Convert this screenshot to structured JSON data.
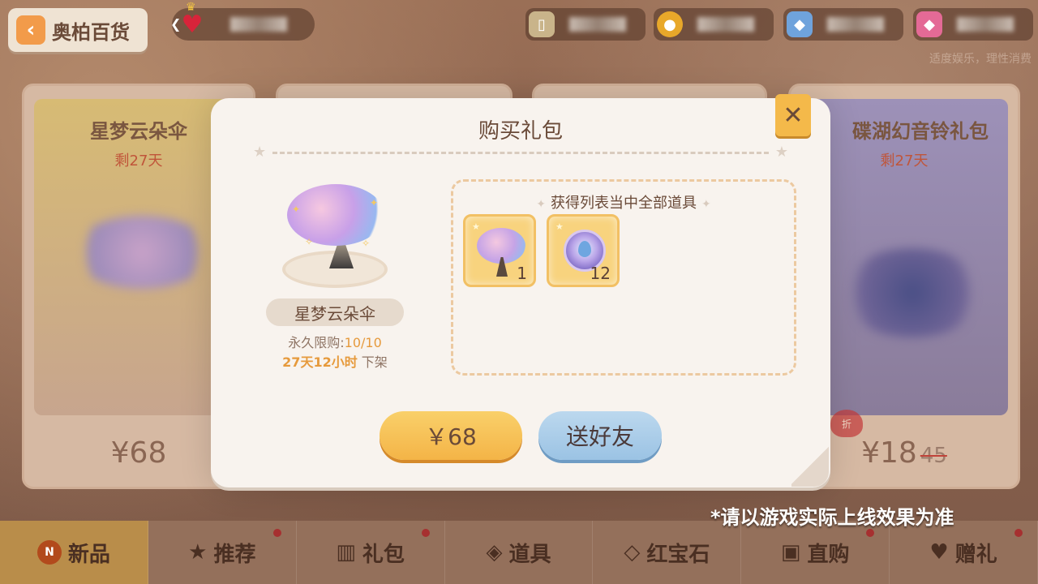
{
  "header": {
    "back_label": "奥柏百货",
    "notice": "适度娱乐，理性消费"
  },
  "background_cards": [
    {
      "name": "星梦云朵伞",
      "days": "剩27天",
      "price": "¥68"
    },
    {
      "name": "碟湖幻音铃礼包",
      "days": "剩27天",
      "price": "¥18",
      "old_price": "45",
      "discount_label": "折"
    }
  ],
  "dialog": {
    "title": "购买礼包",
    "item_name": "星梦云朵伞",
    "limit_label": "永久限购:",
    "limit_value": "10/10",
    "time_value": "27天12小时",
    "time_suffix": " 下架",
    "contents_title": "获得列表当中全部道具",
    "rewards": [
      {
        "icon": "cloud-umbrella-icon",
        "count": "1"
      },
      {
        "icon": "crystal-orb-icon",
        "count": "12"
      }
    ],
    "buy_label": "￥68",
    "gift_label": "送好友",
    "close_symbol": "✕"
  },
  "nav": {
    "items": [
      {
        "label": "新品",
        "icon": "new-icon",
        "badge": "N"
      },
      {
        "label": "推荐",
        "icon": "star-icon"
      },
      {
        "label": "礼包",
        "icon": "gift-icon"
      },
      {
        "label": "道具",
        "icon": "prop-icon"
      },
      {
        "label": "红宝石",
        "icon": "gem-icon"
      },
      {
        "label": "直购",
        "icon": "bag-icon"
      },
      {
        "label": "赠礼",
        "icon": "heart-icon"
      }
    ]
  },
  "disclaimer": "*请以游戏实际上线效果为准",
  "colors": {
    "accent": "#f4b447",
    "gift_button": "#9bc3e4",
    "timer": "#e69a3c"
  }
}
